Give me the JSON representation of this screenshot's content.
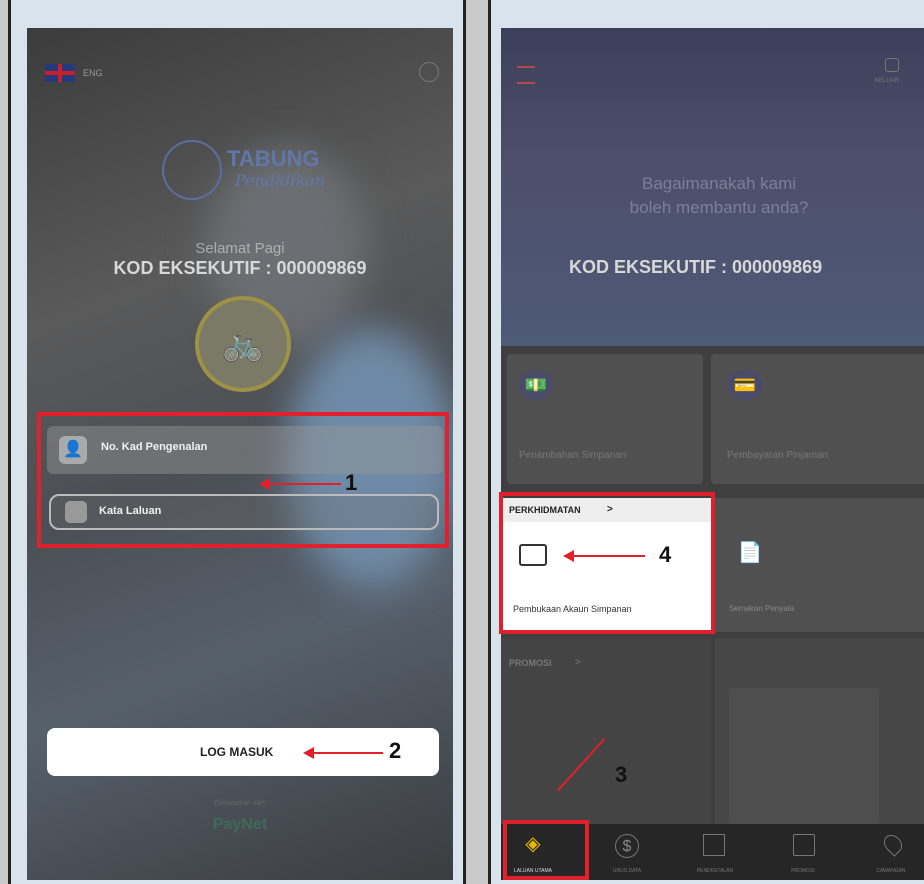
{
  "left": {
    "language": "ENG",
    "logo_line1": "TABUNG",
    "logo_line2": "Pendidikan",
    "greeting": "Selamat Pagi",
    "executive_code": "KOD EKSEKUTIF : 000009869",
    "id_field_placeholder": "No. Kad Pengenalan",
    "password_field_placeholder": "Kata Laluan",
    "login_button": "LOG MASUK",
    "powered_by": "Dikuasakan oleh",
    "paynet": "PayNet",
    "callout_1": "1",
    "callout_2": "2"
  },
  "right": {
    "logout_label": "KELUAR",
    "help_line1": "Bagaimanakah kami",
    "help_line2": "boleh membantu anda?",
    "executive_code": "KOD EKSEKUTIF : 000009869",
    "tile_add_savings": "Penambahan Simpanan",
    "tile_loan_payment": "Pembayaran Pinjaman",
    "services_header": "PERKHIDMATAN",
    "tile_open_account": "Pembukaan Akaun Simpanan",
    "tile_statement": "Semakan Penyata",
    "promo_header": "PROMOSI",
    "nav": [
      "LALUAN UTAMA",
      "URUS DATA",
      "PENDIGITALAN",
      "PROMOSI",
      "CAWANGAN"
    ],
    "callout_3": "3",
    "callout_4": "4"
  },
  "colors": {
    "callout_red": "#e0202a",
    "active_nav": "#e6b800"
  }
}
